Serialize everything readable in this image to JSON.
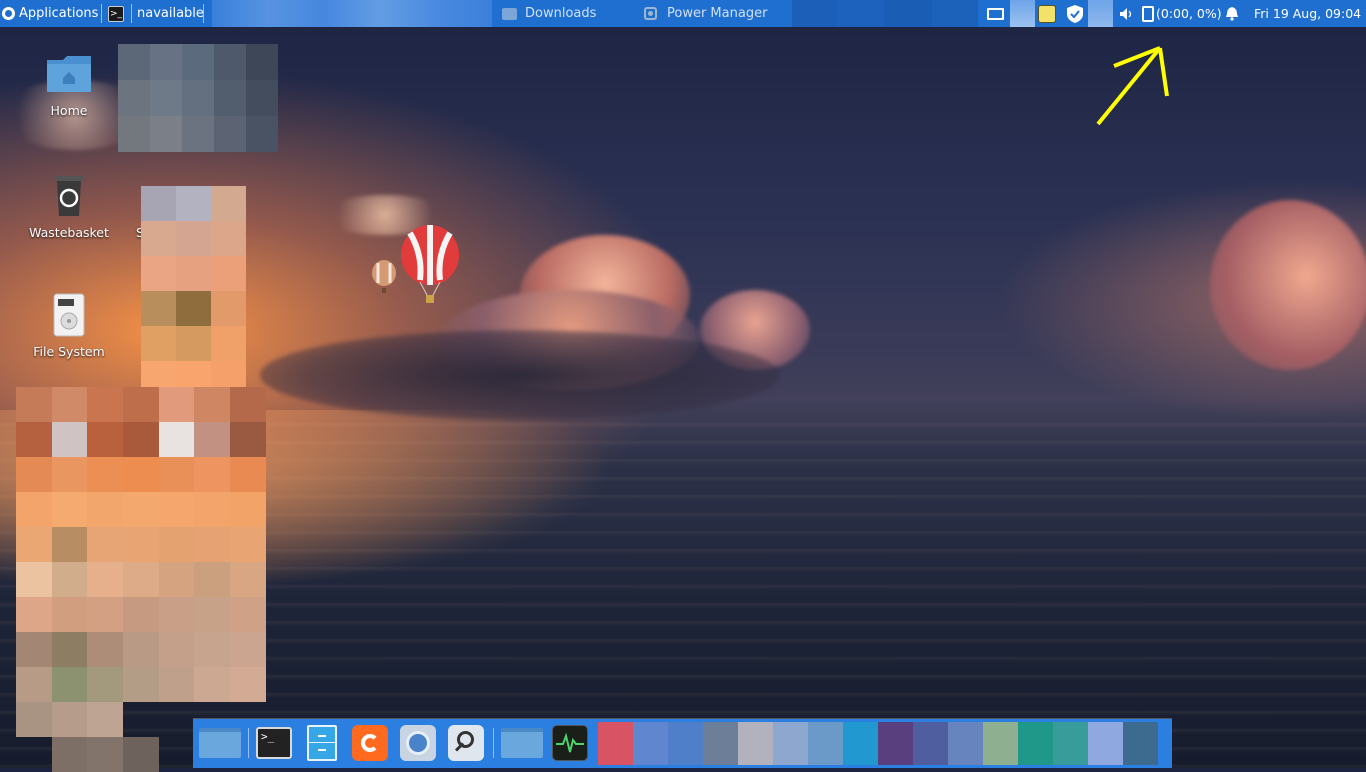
{
  "top_panel": {
    "applications_label": "Applications",
    "window_title_partial": "navailable",
    "tasks": [
      {
        "label": "Downloads",
        "icon": "folder-icon"
      },
      {
        "label": "Power Manager",
        "icon": "power-manager-icon"
      }
    ],
    "battery_text": "(0:00, 0%)",
    "clock": "Fri 19 Aug, 09:04"
  },
  "desktop": {
    "icons": [
      {
        "label": "Home",
        "icon": "home-folder-icon"
      },
      {
        "label": "Wastebasket",
        "icon": "trash-icon"
      },
      {
        "label": "File System",
        "icon": "drive-icon"
      }
    ],
    "clipped_label": "S"
  },
  "dock": {
    "launchers": [
      {
        "name": "show-desktop",
        "icon": "folder-icon"
      },
      {
        "name": "terminal",
        "icon": "terminal-icon"
      },
      {
        "name": "file-cabinet",
        "icon": "file-cabinet-icon"
      },
      {
        "name": "firefox",
        "icon": "firefox-icon"
      },
      {
        "name": "chromium",
        "icon": "chromium-icon"
      },
      {
        "name": "search",
        "icon": "search-icon"
      },
      {
        "name": "files",
        "icon": "folder-icon"
      },
      {
        "name": "system-monitor",
        "icon": "activity-monitor-icon"
      }
    ]
  },
  "colors": {
    "panel_blue": "#1f6fd0",
    "dock_blue": "#2a7fe0",
    "annotation_yellow": "#ffff00"
  }
}
